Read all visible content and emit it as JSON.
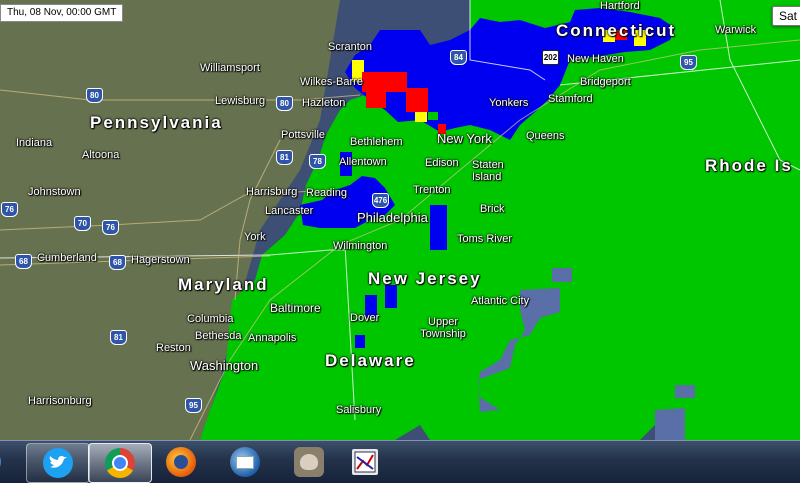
{
  "map": {
    "timestamp": "Thu, 08 Nov, 00:00 GMT",
    "layer_button": "Sat",
    "colors": {
      "radar_green": "#00c600",
      "radar_blue": "#0000f0",
      "radar_red": "#ff0000",
      "radar_yellow": "#ffff00",
      "radar_slate": "#5a6fa8",
      "water": "#3e4f75",
      "taskbar": "#1e2d45"
    },
    "states": [
      {
        "id": "pennsylvania",
        "name": "Pennsylvania"
      },
      {
        "id": "maryland",
        "name": "Maryland"
      },
      {
        "id": "new-jersey",
        "name": "New Jersey"
      },
      {
        "id": "delaware",
        "name": "Delaware"
      },
      {
        "id": "connecticut",
        "name": "Connecticut"
      },
      {
        "id": "rhode-island",
        "name": "Rhode Is"
      }
    ],
    "cities": [
      {
        "id": "scranton",
        "name": "Scranton"
      },
      {
        "id": "williamsport",
        "name": "Williamsport"
      },
      {
        "id": "wilkes-barre",
        "name": "Wilkes-Barre"
      },
      {
        "id": "lewisburg",
        "name": "Lewisburg"
      },
      {
        "id": "hazleton",
        "name": "Hazleton"
      },
      {
        "id": "indiana",
        "name": "Indiana"
      },
      {
        "id": "altoona",
        "name": "Altoona"
      },
      {
        "id": "pottsville",
        "name": "Pottsville"
      },
      {
        "id": "bethlehem",
        "name": "Bethlehem"
      },
      {
        "id": "allentown",
        "name": "Allentown"
      },
      {
        "id": "johnstown",
        "name": "Johnstown"
      },
      {
        "id": "harrisburg",
        "name": "Harrisburg"
      },
      {
        "id": "reading",
        "name": "Reading"
      },
      {
        "id": "lancaster",
        "name": "Lancaster"
      },
      {
        "id": "york",
        "name": "York"
      },
      {
        "id": "philadelphia",
        "name": "Philadelphia"
      },
      {
        "id": "trenton",
        "name": "Trenton"
      },
      {
        "id": "edison",
        "name": "Edison"
      },
      {
        "id": "staten-island",
        "name": "Staten Island"
      },
      {
        "id": "new-york",
        "name": "New York"
      },
      {
        "id": "queens",
        "name": "Queens"
      },
      {
        "id": "yonkers",
        "name": "Yonkers"
      },
      {
        "id": "stamford",
        "name": "Stamford"
      },
      {
        "id": "bridgeport",
        "name": "Bridgeport"
      },
      {
        "id": "new-haven",
        "name": "New Haven"
      },
      {
        "id": "hartford",
        "name": "Hartford"
      },
      {
        "id": "warwick",
        "name": "Warwick"
      },
      {
        "id": "brick",
        "name": "Brick"
      },
      {
        "id": "toms-river",
        "name": "Toms River"
      },
      {
        "id": "wilmington",
        "name": "Wilmington"
      },
      {
        "id": "cumberland",
        "name": "Cumberland"
      },
      {
        "id": "hagerstown",
        "name": "Hagerstown"
      },
      {
        "id": "baltimore",
        "name": "Baltimore"
      },
      {
        "id": "columbia",
        "name": "Columbia"
      },
      {
        "id": "bethesda",
        "name": "Bethesda"
      },
      {
        "id": "annapolis",
        "name": "Annapolis"
      },
      {
        "id": "reston",
        "name": "Reston"
      },
      {
        "id": "washington",
        "name": "Washington"
      },
      {
        "id": "dover",
        "name": "Dover"
      },
      {
        "id": "atlantic-city",
        "name": "Atlantic City"
      },
      {
        "id": "upper-township",
        "name": "Upper Township"
      },
      {
        "id": "salisbury",
        "name": "Salisbury"
      },
      {
        "id": "harrisonburg",
        "name": "Harrisonburg"
      }
    ],
    "highways": [
      "80",
      "80",
      "84",
      "202",
      "95",
      "81",
      "78",
      "476",
      "76",
      "70",
      "76",
      "68",
      "68",
      "81",
      "95"
    ]
  },
  "taskbar": {
    "apps": [
      {
        "id": "twitter",
        "icon": "twitter-bird-icon",
        "state": "pinned"
      },
      {
        "id": "chrome",
        "icon": "chrome-icon",
        "state": "active"
      },
      {
        "id": "firefox",
        "icon": "firefox-icon",
        "state": "normal"
      },
      {
        "id": "thunderbird",
        "icon": "thunderbird-icon",
        "state": "normal"
      },
      {
        "id": "gimp",
        "icon": "gimp-icon",
        "state": "normal"
      },
      {
        "id": "radar-app",
        "icon": "radar-app-icon",
        "state": "normal"
      }
    ]
  }
}
